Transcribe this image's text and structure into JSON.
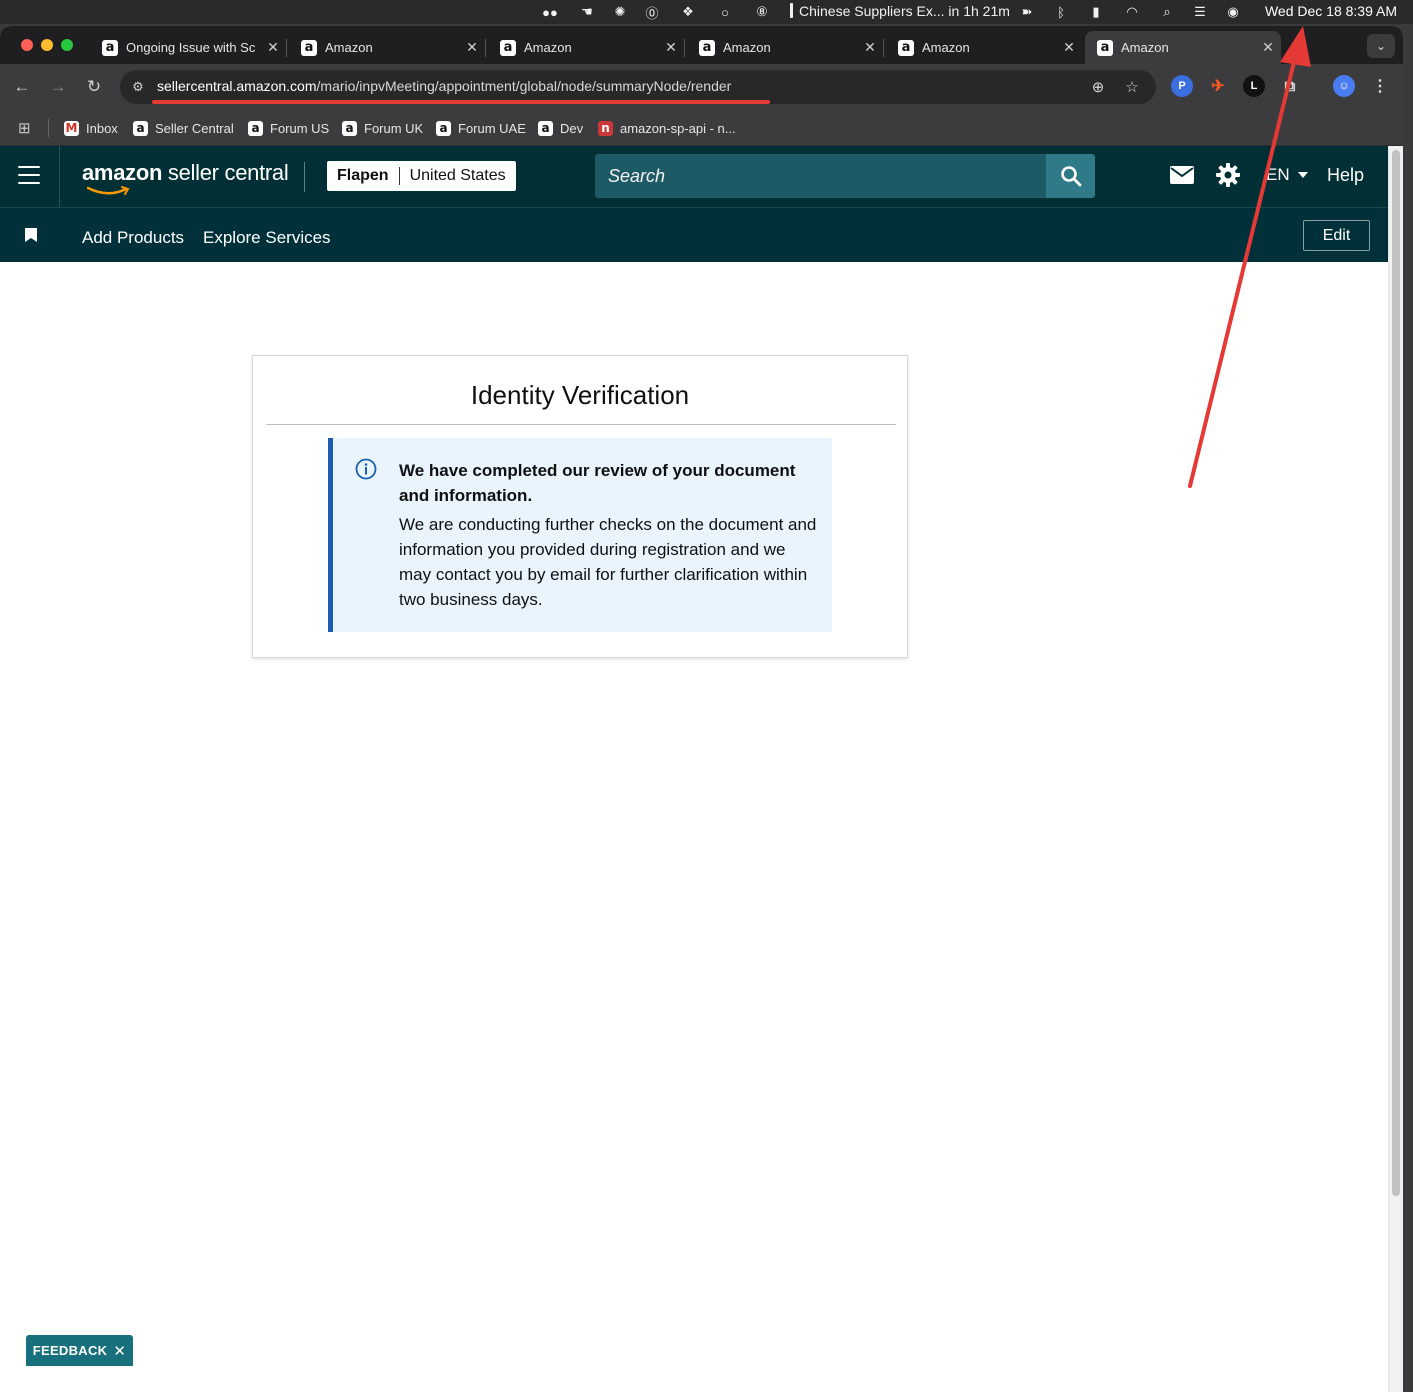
{
  "menubar": {
    "event": "Chinese Suppliers Ex... in 1h 21m",
    "clock": "Wed Dec 18  8:39 AM"
  },
  "tabs": [
    {
      "title": "Ongoing Issue with Sc",
      "favicon": "a",
      "active": false
    },
    {
      "title": "Amazon",
      "favicon": "a",
      "active": false
    },
    {
      "title": "Amazon",
      "favicon": "a",
      "active": false
    },
    {
      "title": "Amazon",
      "favicon": "a",
      "active": false
    },
    {
      "title": "Amazon",
      "favicon": "a",
      "active": false
    },
    {
      "title": "Amazon",
      "favicon": "a",
      "active": true
    }
  ],
  "address_bar": {
    "host": "sellercentral.amazon.com",
    "path": "/mario/inpvMeeting/appointment/global/node/summaryNode/render"
  },
  "bookmarks": [
    {
      "label": "Inbox",
      "favicon": "M"
    },
    {
      "label": "Seller Central",
      "favicon": "a"
    },
    {
      "label": "Forum US",
      "favicon": "a"
    },
    {
      "label": "Forum UK",
      "favicon": "a"
    },
    {
      "label": "Forum UAE",
      "favicon": "a"
    },
    {
      "label": "Dev",
      "favicon": "a"
    },
    {
      "label": "amazon-sp-api - n...",
      "favicon": "n"
    }
  ],
  "header": {
    "logo_brand": "amazon",
    "logo_product": " seller central",
    "store_name": "Flapen",
    "marketplace": "United States",
    "search_placeholder": "Search",
    "language": "EN",
    "help": "Help"
  },
  "subnav": {
    "items": [
      "Add Products",
      "Explore Services"
    ],
    "edit": "Edit"
  },
  "card": {
    "title": "Identity Verification",
    "alert_heading": "We have completed our review of your document and information.",
    "alert_body": "We are conducting further checks on the document and information you provided during registration and we may contact you by email for further clarification within two business days."
  },
  "feedback": {
    "label": "FEEDBACK",
    "close": "✕"
  },
  "colors": {
    "header_bg": "#002f36",
    "search_bg": "#1e5a65",
    "search_button": "#2f7a88",
    "alert_bg": "#eaf4fe",
    "alert_border": "#1a5faf",
    "annotation": "#e53935",
    "feedback_bg": "#17707c"
  }
}
